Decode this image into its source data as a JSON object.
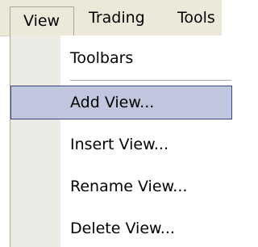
{
  "menubar": {
    "items": [
      {
        "label": "View"
      },
      {
        "label": "Trading"
      },
      {
        "label": "Tools"
      }
    ]
  },
  "view_menu": {
    "items": [
      {
        "label": "Toolbars"
      },
      {
        "label": "Add View..."
      },
      {
        "label": "Insert View..."
      },
      {
        "label": "Rename View..."
      },
      {
        "label": "Delete View..."
      }
    ],
    "selected_item": "Add View..."
  },
  "colors": {
    "menubar_bg": "#ece9d8",
    "gutter_bg": "#ebeae4",
    "highlight_bg": "#c0c6dd",
    "highlight_border": "#37457a"
  }
}
